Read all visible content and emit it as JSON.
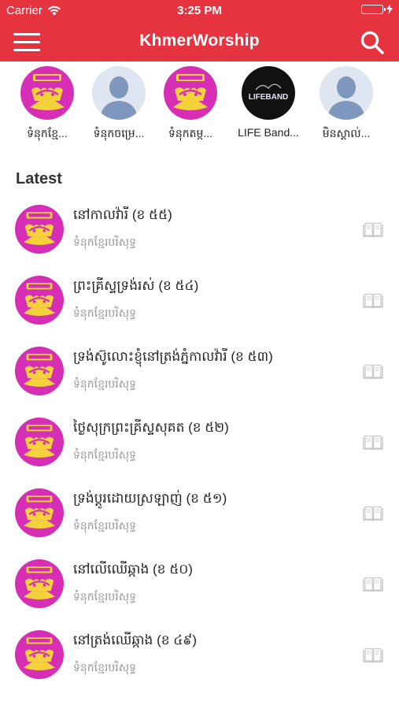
{
  "status_bar": {
    "carrier": "Carrier",
    "time": "3:25 PM"
  },
  "nav": {
    "title": "KhmerWorship"
  },
  "stories": [
    {
      "label": "ទំនុកខ្មែ...",
      "kind": "logo"
    },
    {
      "label": "ទំនុកចម្រេ...",
      "kind": "person"
    },
    {
      "label": "ទំនុកតម្ក...",
      "kind": "logo"
    },
    {
      "label": "LIFE Band...",
      "kind": "lifeband"
    },
    {
      "label": "មិនស្គាល់...",
      "kind": "person"
    }
  ],
  "logo_text": {
    "lifeband": "LIFEBAND"
  },
  "section": {
    "title": "Latest"
  },
  "songs": [
    {
      "title": "នៅកាលវ៉ារី (ខ ៥៥)",
      "subtitle": "ទំនុកខ្មែរបរិសុទ្ធ"
    },
    {
      "title": "ព្រះគ្រីស្ទទ្រង់រស់ (ខ ៥៤)",
      "subtitle": "ទំនុកខ្មែរបរិសុទ្ធ"
    },
    {
      "title": "ទ្រង់ស៊ូលោះខ្ញុំនៅត្រង់ភ្នំកាលវ៉ារី (ខ ៥៣)",
      "subtitle": "ទំនុកខ្មែរបរិសុទ្ធ"
    },
    {
      "title": "ថ្ងៃសុក្រព្រះគ្រីស្ទសុគត (ខ ៥២)",
      "subtitle": "ទំនុកខ្មែរបរិសុទ្ធ"
    },
    {
      "title": "ទ្រង់ប្តូរដោយស្រឡាញ់ (ខ ៥១)",
      "subtitle": "ទំនុកខ្មែរបរិសុទ្ធ"
    },
    {
      "title": "នៅលើឈើឆ្កាង (ខ ៥០)",
      "subtitle": "ទំនុកខ្មែរបរិសុទ្ធ"
    },
    {
      "title": "នៅត្រង់ឈើឆ្កាង (ខ ៤៩)",
      "subtitle": "ទំនុកខ្មែរបរិសុទ្ធ"
    }
  ],
  "colors": {
    "brand": "#e5343f",
    "logo_pink": "#d62fb5",
    "logo_yellow": "#f4d23a"
  }
}
